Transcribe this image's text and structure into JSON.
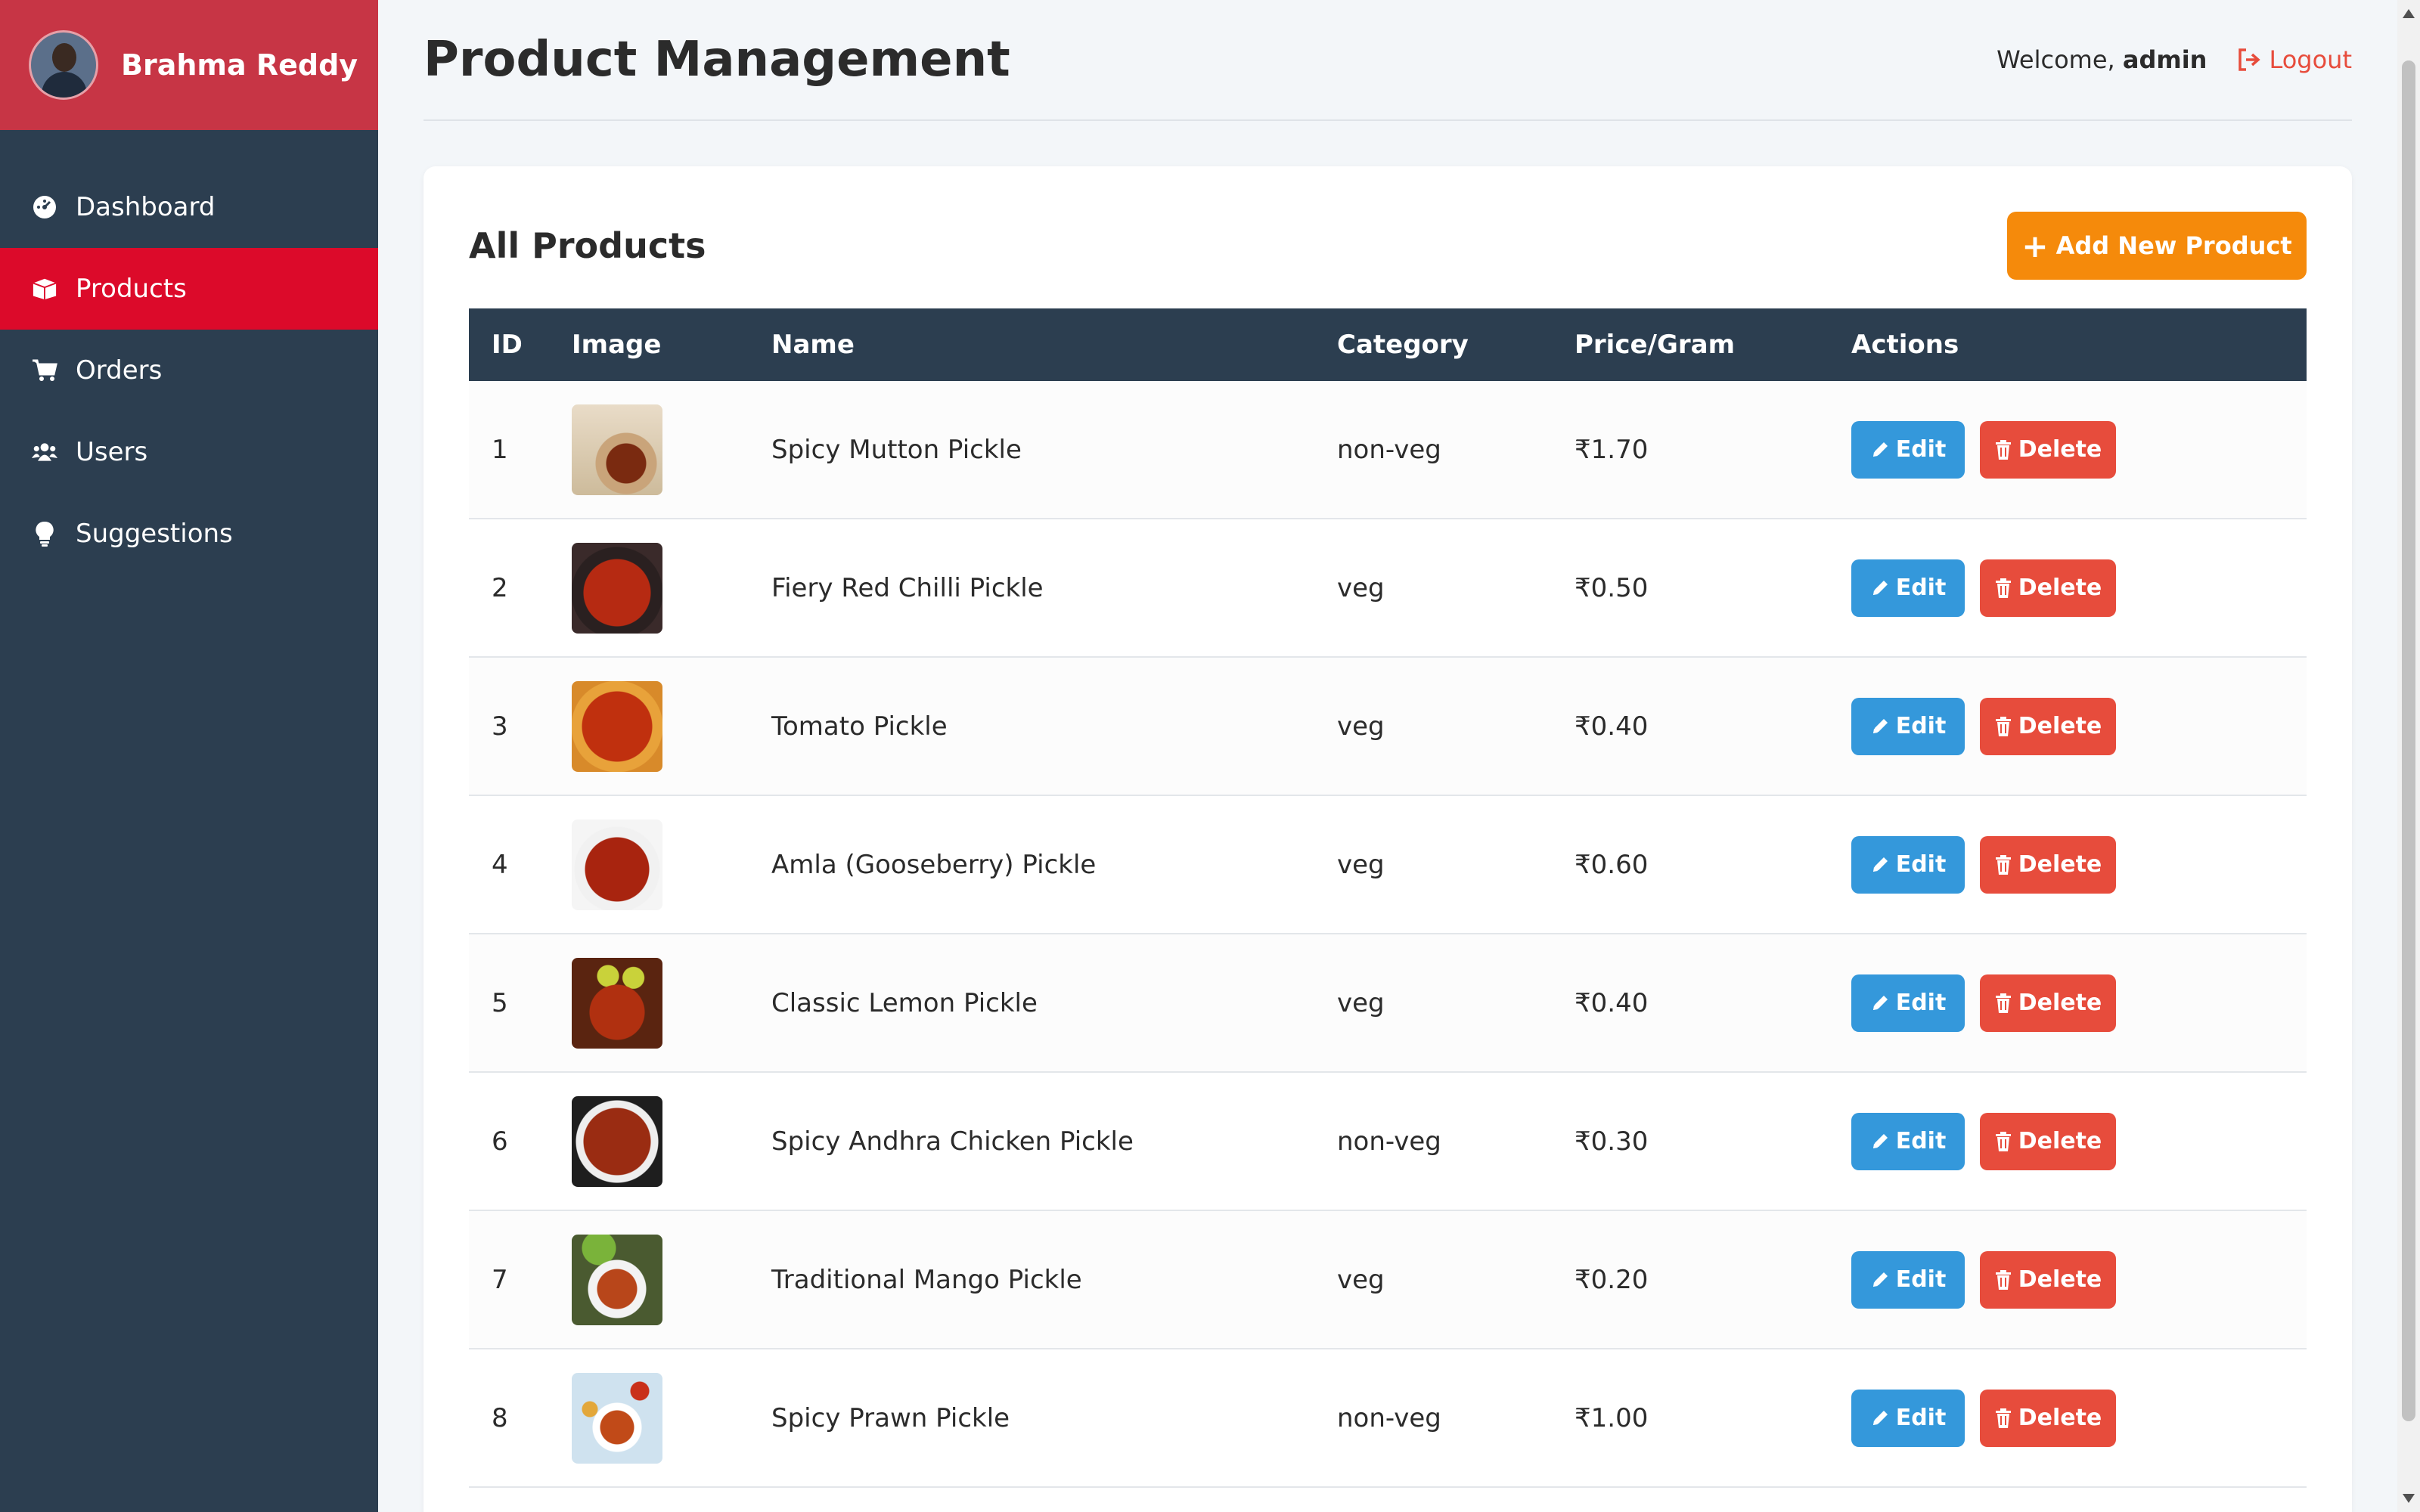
{
  "sidebar": {
    "brand_name": "Brahma Reddy",
    "items": [
      {
        "label": "Dashboard",
        "icon": "dashboard-icon",
        "active": false
      },
      {
        "label": "Products",
        "icon": "box-icon",
        "active": true
      },
      {
        "label": "Orders",
        "icon": "cart-icon",
        "active": false
      },
      {
        "label": "Users",
        "icon": "users-icon",
        "active": false
      },
      {
        "label": "Suggestions",
        "icon": "lightbulb-icon",
        "active": false
      }
    ]
  },
  "header": {
    "title": "Product Management",
    "welcome_prefix": "Welcome,",
    "username": "admin",
    "logout_label": "Logout"
  },
  "card": {
    "title": "All Products",
    "add_button_label": "Add New Product"
  },
  "table": {
    "columns": [
      "ID",
      "Image",
      "Name",
      "Category",
      "Price/Gram",
      "Actions"
    ],
    "rows": [
      {
        "id": "1",
        "name": "Spicy Mutton Pickle",
        "category": "non-veg",
        "price": "₹1.70"
      },
      {
        "id": "2",
        "name": "Fiery Red Chilli Pickle",
        "category": "veg",
        "price": "₹0.50"
      },
      {
        "id": "3",
        "name": "Tomato Pickle",
        "category": "veg",
        "price": "₹0.40"
      },
      {
        "id": "4",
        "name": "Amla (Gooseberry) Pickle",
        "category": "veg",
        "price": "₹0.60"
      },
      {
        "id": "5",
        "name": "Classic Lemon Pickle",
        "category": "veg",
        "price": "₹0.40"
      },
      {
        "id": "6",
        "name": "Spicy Andhra Chicken Pickle",
        "category": "non-veg",
        "price": "₹0.30"
      },
      {
        "id": "7",
        "name": "Traditional Mango Pickle",
        "category": "veg",
        "price": "₹0.20"
      },
      {
        "id": "8",
        "name": "Spicy Prawn Pickle",
        "category": "non-veg",
        "price": "₹1.00"
      }
    ],
    "edit_label": "Edit",
    "delete_label": "Delete"
  },
  "colors": {
    "sidebar_bg": "#2c3e50",
    "brand_bg": "#c73545",
    "active_nav": "#dc0a2a",
    "add_button": "#f58a0b",
    "edit_button": "#3498db",
    "delete_button": "#e74c3c"
  }
}
